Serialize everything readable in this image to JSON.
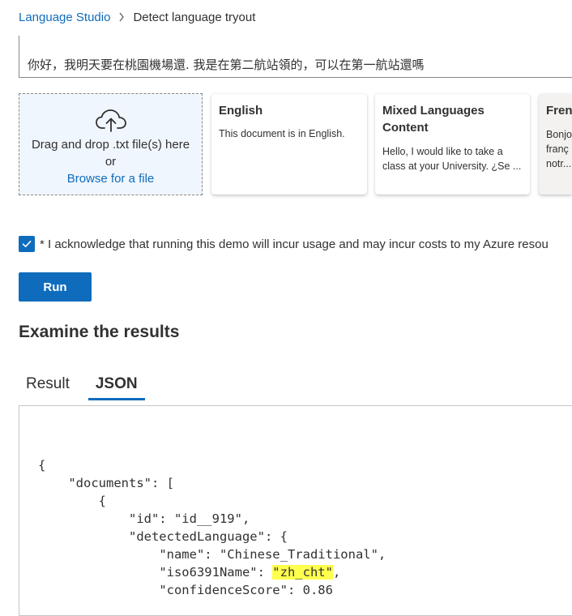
{
  "breadcrumb": {
    "root": "Language Studio",
    "current": "Detect language tryout"
  },
  "input": {
    "text": "你好，我明天要在桃園機場還. 我是在第二航站領的，可以在第一航站還嗎"
  },
  "dropzone": {
    "line1": "Drag and drop .txt file(s) here",
    "line2": "or",
    "browse": "Browse for a file",
    "icon": "cloud-upload-icon"
  },
  "samples": [
    {
      "title": "English",
      "body": "This document is in English."
    },
    {
      "title": "Mixed Languages Content",
      "body": "Hello, I would like to take a class at your University. ¿Se ..."
    },
    {
      "title": "Fren",
      "body": "Bonjo franç notr..."
    }
  ],
  "acknowledge": {
    "checked": true,
    "text": "* I acknowledge that running this demo will incur usage and may incur costs to my Azure resou"
  },
  "run_button": {
    "label": "Run"
  },
  "results": {
    "heading": "Examine the results"
  },
  "tabs": [
    {
      "label": "Result",
      "active": false
    },
    {
      "label": "JSON",
      "active": true
    }
  ],
  "json_view": {
    "open_brace": "{",
    "documents_key": "\"documents\": [",
    "item_open": "{",
    "id_line": "\"id\": \"id__919\",",
    "detected_key": "\"detectedLanguage\": {",
    "name_line": "\"name\": \"Chinese_Traditional\",",
    "iso_key": "\"iso6391Name\": ",
    "iso_value": "\"zh_cht\"",
    "iso_comma": ",",
    "confidence_line": "\"confidenceScore\": 0.86"
  },
  "colors": {
    "accent": "#0f6cbd",
    "highlight": "#ffff4d",
    "dropzone_bg": "#f0f6fd"
  }
}
